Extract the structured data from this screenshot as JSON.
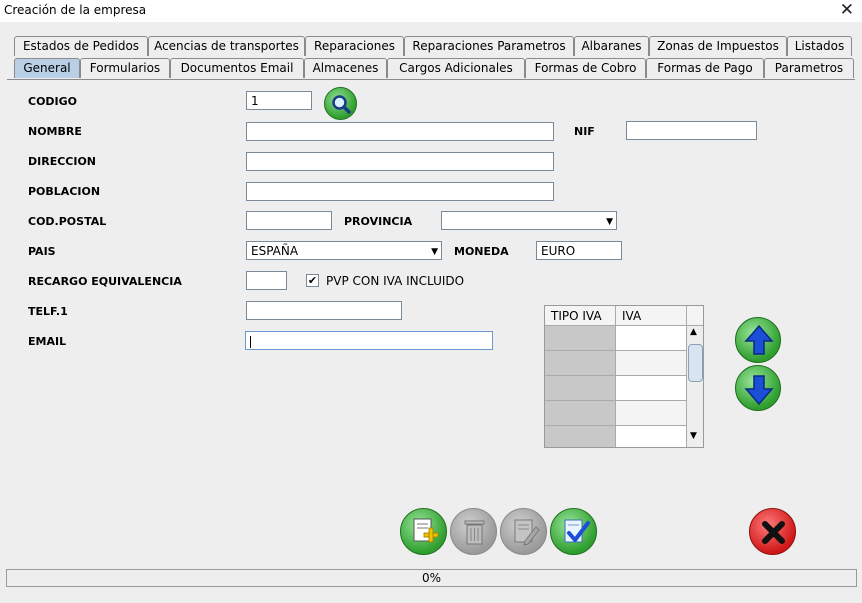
{
  "window": {
    "title": "Creación de la empresa"
  },
  "tabs_row1": [
    "Estados de Pedidos",
    "Acencias de transportes",
    "Reparaciones",
    "Reparaciones Parametros",
    "Albaranes",
    "Zonas de Impuestos",
    "Listados"
  ],
  "tabs_row2": [
    "General",
    "Formularios",
    "Documentos Email",
    "Almacenes",
    "Cargos Adicionales",
    "Formas de Cobro",
    "Formas de Pago",
    "Parametros"
  ],
  "active_tab": "General",
  "form": {
    "codigo_label": "CODIGO",
    "codigo_value": "1",
    "nombre_label": "NOMBRE",
    "nombre_value": "",
    "nif_label": "NIF",
    "nif_value": "",
    "direccion_label": "DIRECCION",
    "direccion_value": "",
    "poblacion_label": "POBLACION",
    "poblacion_value": "",
    "codpostal_label": "COD.POSTAL",
    "codpostal_value": "",
    "provincia_label": "PROVINCIA",
    "provincia_value": "",
    "pais_label": "PAIS",
    "pais_value": "ESPAÑA",
    "moneda_label": "MONEDA",
    "moneda_value": "EURO",
    "recargo_label": "RECARGO EQUIVALENCIA",
    "recargo_value": "",
    "pvp_label": "PVP CON IVA INCLUIDO",
    "pvp_checked": true,
    "telf_label": "TELF.1",
    "telf_value": "",
    "email_label": "EMAIL",
    "email_value": ""
  },
  "iva_table": {
    "headers": [
      "TIPO IVA",
      "IVA"
    ],
    "rows": 5
  },
  "progress": {
    "text": "0%",
    "value": 0
  },
  "colors": {
    "tab_active": "#b8cfe5",
    "green": "#3cae3c",
    "blue_arrow": "#1b4fd8",
    "red": "#e02020",
    "disabled": "#a8a8a8"
  }
}
